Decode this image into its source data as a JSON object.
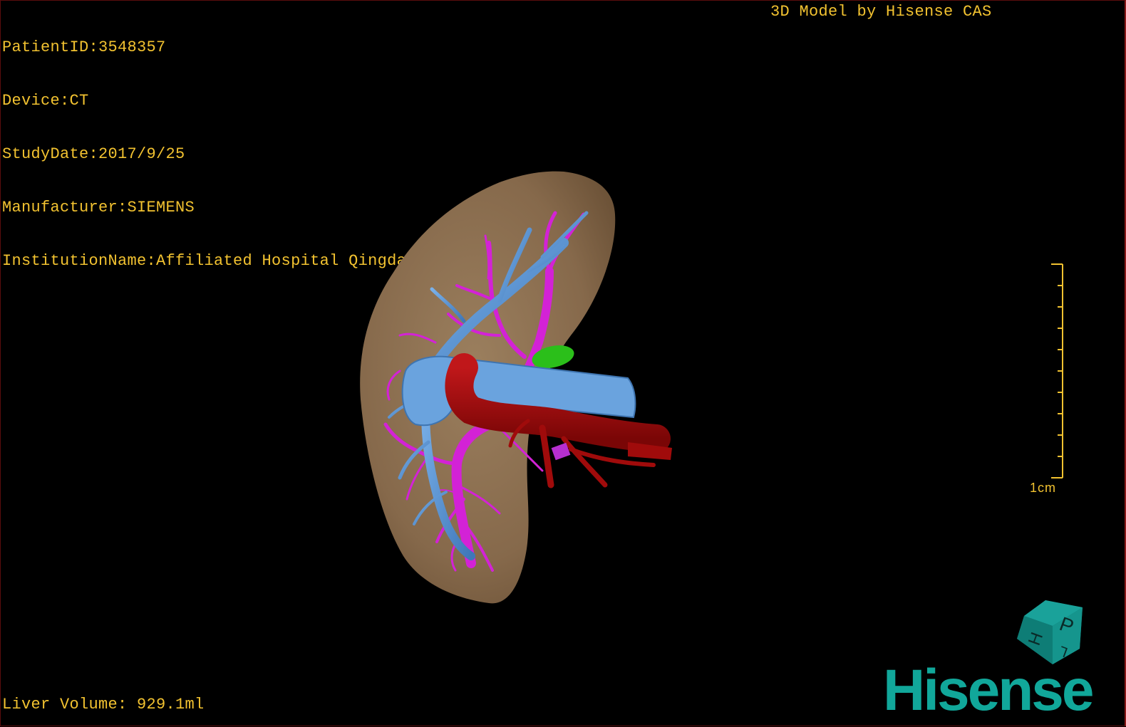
{
  "header": {
    "patient_id": "PatientID:3548357",
    "device": "Device:CT",
    "study_date": "StudyDate:2017/9/25",
    "manufacturer": "Manufacturer:SIEMENS",
    "institution": "InstitutionName:Affiliated Hospital Qingdao University-C"
  },
  "credit": "3D Model by Hisense CAS",
  "footer": {
    "liver_volume": "Liver Volume: 929.1ml"
  },
  "scale": {
    "label": "1cm",
    "ticks": 10
  },
  "orientation_cube": {
    "face_letters": [
      "P",
      "H",
      "L"
    ]
  },
  "brand": {
    "logo_text": "Hisense"
  },
  "colors": {
    "overlay_text": "#f2c230",
    "liver_parenchyma": "#8a7052",
    "hepatic_veins": "#5f97d6",
    "portal_vein": "#d322d6",
    "hepatic_artery": "#a00b0b",
    "gallbladder": "#2bbf1a",
    "brand": "#11a79a"
  }
}
